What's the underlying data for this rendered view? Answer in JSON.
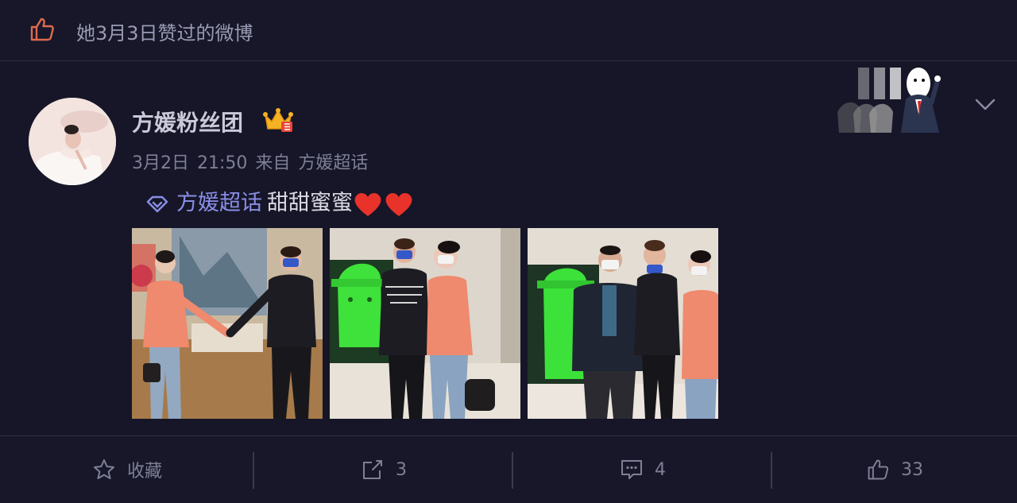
{
  "header": {
    "title": "她3月3日赞过的微博",
    "icon": "thumbs-up-icon"
  },
  "post": {
    "username": "方媛粉丝团",
    "badge": "crown-badge-icon",
    "meta": {
      "date": "3月2日",
      "time": "21:50",
      "source_prefix": "来自",
      "source": "方媛超话"
    },
    "topic": "方媛超话",
    "text": "甜甜蜜蜜",
    "emoji": [
      "red-heart",
      "red-heart"
    ],
    "photos": [
      "photo-1",
      "photo-2",
      "photo-3"
    ]
  },
  "actions": {
    "favorite_label": "收藏",
    "repost_count": "3",
    "comment_count": "4",
    "like_count": "33"
  },
  "colors": {
    "background": "#161628",
    "topic": "#8a8ee6",
    "like_icon": "#e06a4f",
    "heart": "#e8322a"
  }
}
